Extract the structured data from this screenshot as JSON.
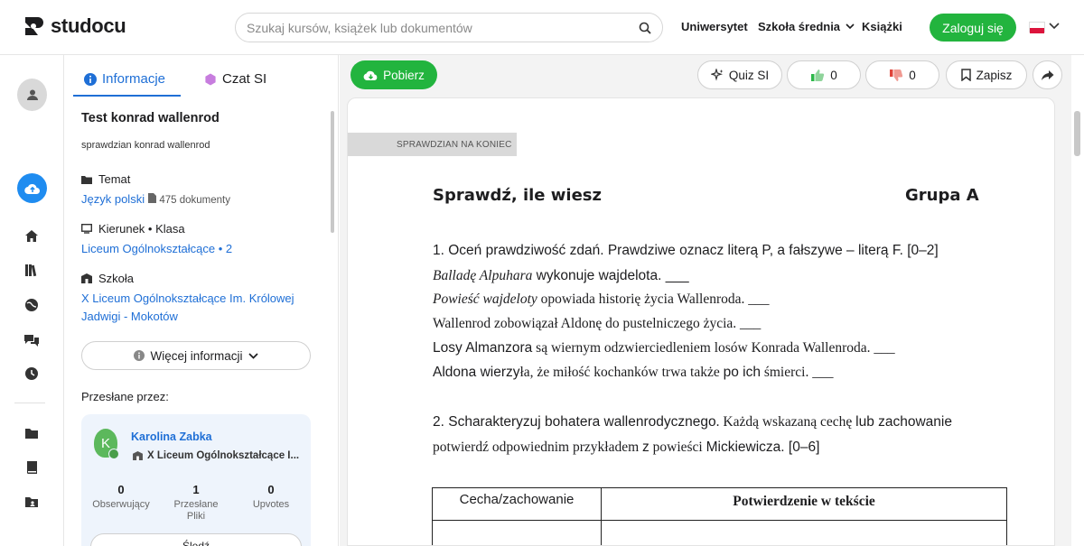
{
  "brand": {
    "name": "studocu"
  },
  "header": {
    "search_placeholder": "Szukaj kursów, książek lub dokumentów",
    "nav": [
      "Uniwersytet",
      "Szkoła średnia",
      "Książki"
    ],
    "login_label": "Zaloguj się"
  },
  "info_panel": {
    "tabs": [
      "Informacje",
      "Czat SI"
    ],
    "doc_title": "Test konrad wallenrod",
    "doc_description": "sprawdzian konrad wallenrod",
    "topic_label": "Temat",
    "topic_value": "Język polski",
    "topic_docs": "475 dokumenty",
    "direction_label": "Kierunek • Klasa",
    "direction_value": "Liceum Ogólnokształcące • 2",
    "school_label": "Szkoła",
    "school_value_line1": "X Liceum Ogólnokształcące Im. Królowej",
    "school_value_line2": "Jadwigi - Mokotów",
    "more_info_label": "Więcej informacji",
    "uploaded_by_label": "Przesłane przez:",
    "user": {
      "initial": "K",
      "name": "Karolina Zabka",
      "school": "X Liceum Ogólnokształcące I...",
      "stats": [
        {
          "value": "0",
          "label": "Obserwujący"
        },
        {
          "value": "1",
          "label": "Przesłane Pliki"
        },
        {
          "value": "0",
          "label": "Upvotes"
        }
      ],
      "follow_label": "Śledź"
    }
  },
  "toolbar": {
    "download_label": "Pobierz",
    "quiz_label": "Quiz SI",
    "likes": "0",
    "dislikes": "0",
    "save_label": "Zapisz"
  },
  "document": {
    "header_tab": "SPRAWDZIAN NA KONIEC",
    "title": "Sprawdź, ile wiesz",
    "group": "Grupa A",
    "q1_intro": "1. Oceń prawdziwość zdań. Prawdziwe oznacz literą P, a fałszywe – literą F. [0–2]",
    "q1_a_italic": "Balladę Alpuhara",
    "q1_a_rest": " wykonuje wajdelota. ___",
    "q1_b_italic": "Powieść wajdeloty",
    "q1_b_rest": " opowiada historię życia Wallenroda. ___",
    "q1_c": "Wallenrod zobowiązał Aldonę do pustelniczego życia. ___",
    "q1_d_sans": "Losy Almanzora",
    "q1_d_rest": " są wiernym odzwierciedleniem losów Konrada Wallenroda. ___",
    "q1_e_sans": "Aldona wierzy",
    "q1_e_rest1": "ła, że miłość kochanków trwa także ",
    "q1_e_sans2": "po ich",
    "q1_e_rest2": " śmierci. ___",
    "q2_line1_sans": "2. Scharakteryzuj bohatera wallenrodycznego",
    "q2_line1_serif": ". Każdą wskazaną cechę ",
    "q2_line1_sans2": "lub zachowanie",
    "q2_line2_serif": "potwierdź odpowiednim przykładem ",
    "q2_line2_sans": "z",
    "q2_line2_serif2": " powieści ",
    "q2_line2_sans2": "Mickiewicza. [0–6]",
    "table_headers": [
      "Cecha/zachowanie",
      "Potwierdzenie w tekście"
    ]
  },
  "colors": {
    "brand_green": "#22b43e",
    "accent_blue": "#1f6fd6"
  }
}
